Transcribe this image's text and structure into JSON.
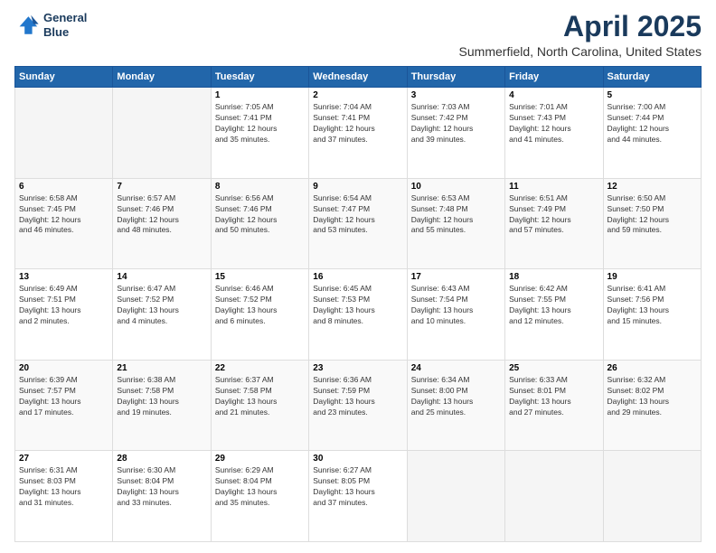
{
  "logo": {
    "line1": "General",
    "line2": "Blue"
  },
  "title": "April 2025",
  "subtitle": "Summerfield, North Carolina, United States",
  "weekdays": [
    "Sunday",
    "Monday",
    "Tuesday",
    "Wednesday",
    "Thursday",
    "Friday",
    "Saturday"
  ],
  "weeks": [
    [
      {
        "day": "",
        "detail": ""
      },
      {
        "day": "",
        "detail": ""
      },
      {
        "day": "1",
        "detail": "Sunrise: 7:05 AM\nSunset: 7:41 PM\nDaylight: 12 hours\nand 35 minutes."
      },
      {
        "day": "2",
        "detail": "Sunrise: 7:04 AM\nSunset: 7:41 PM\nDaylight: 12 hours\nand 37 minutes."
      },
      {
        "day": "3",
        "detail": "Sunrise: 7:03 AM\nSunset: 7:42 PM\nDaylight: 12 hours\nand 39 minutes."
      },
      {
        "day": "4",
        "detail": "Sunrise: 7:01 AM\nSunset: 7:43 PM\nDaylight: 12 hours\nand 41 minutes."
      },
      {
        "day": "5",
        "detail": "Sunrise: 7:00 AM\nSunset: 7:44 PM\nDaylight: 12 hours\nand 44 minutes."
      }
    ],
    [
      {
        "day": "6",
        "detail": "Sunrise: 6:58 AM\nSunset: 7:45 PM\nDaylight: 12 hours\nand 46 minutes."
      },
      {
        "day": "7",
        "detail": "Sunrise: 6:57 AM\nSunset: 7:46 PM\nDaylight: 12 hours\nand 48 minutes."
      },
      {
        "day": "8",
        "detail": "Sunrise: 6:56 AM\nSunset: 7:46 PM\nDaylight: 12 hours\nand 50 minutes."
      },
      {
        "day": "9",
        "detail": "Sunrise: 6:54 AM\nSunset: 7:47 PM\nDaylight: 12 hours\nand 53 minutes."
      },
      {
        "day": "10",
        "detail": "Sunrise: 6:53 AM\nSunset: 7:48 PM\nDaylight: 12 hours\nand 55 minutes."
      },
      {
        "day": "11",
        "detail": "Sunrise: 6:51 AM\nSunset: 7:49 PM\nDaylight: 12 hours\nand 57 minutes."
      },
      {
        "day": "12",
        "detail": "Sunrise: 6:50 AM\nSunset: 7:50 PM\nDaylight: 12 hours\nand 59 minutes."
      }
    ],
    [
      {
        "day": "13",
        "detail": "Sunrise: 6:49 AM\nSunset: 7:51 PM\nDaylight: 13 hours\nand 2 minutes."
      },
      {
        "day": "14",
        "detail": "Sunrise: 6:47 AM\nSunset: 7:52 PM\nDaylight: 13 hours\nand 4 minutes."
      },
      {
        "day": "15",
        "detail": "Sunrise: 6:46 AM\nSunset: 7:52 PM\nDaylight: 13 hours\nand 6 minutes."
      },
      {
        "day": "16",
        "detail": "Sunrise: 6:45 AM\nSunset: 7:53 PM\nDaylight: 13 hours\nand 8 minutes."
      },
      {
        "day": "17",
        "detail": "Sunrise: 6:43 AM\nSunset: 7:54 PM\nDaylight: 13 hours\nand 10 minutes."
      },
      {
        "day": "18",
        "detail": "Sunrise: 6:42 AM\nSunset: 7:55 PM\nDaylight: 13 hours\nand 12 minutes."
      },
      {
        "day": "19",
        "detail": "Sunrise: 6:41 AM\nSunset: 7:56 PM\nDaylight: 13 hours\nand 15 minutes."
      }
    ],
    [
      {
        "day": "20",
        "detail": "Sunrise: 6:39 AM\nSunset: 7:57 PM\nDaylight: 13 hours\nand 17 minutes."
      },
      {
        "day": "21",
        "detail": "Sunrise: 6:38 AM\nSunset: 7:58 PM\nDaylight: 13 hours\nand 19 minutes."
      },
      {
        "day": "22",
        "detail": "Sunrise: 6:37 AM\nSunset: 7:58 PM\nDaylight: 13 hours\nand 21 minutes."
      },
      {
        "day": "23",
        "detail": "Sunrise: 6:36 AM\nSunset: 7:59 PM\nDaylight: 13 hours\nand 23 minutes."
      },
      {
        "day": "24",
        "detail": "Sunrise: 6:34 AM\nSunset: 8:00 PM\nDaylight: 13 hours\nand 25 minutes."
      },
      {
        "day": "25",
        "detail": "Sunrise: 6:33 AM\nSunset: 8:01 PM\nDaylight: 13 hours\nand 27 minutes."
      },
      {
        "day": "26",
        "detail": "Sunrise: 6:32 AM\nSunset: 8:02 PM\nDaylight: 13 hours\nand 29 minutes."
      }
    ],
    [
      {
        "day": "27",
        "detail": "Sunrise: 6:31 AM\nSunset: 8:03 PM\nDaylight: 13 hours\nand 31 minutes."
      },
      {
        "day": "28",
        "detail": "Sunrise: 6:30 AM\nSunset: 8:04 PM\nDaylight: 13 hours\nand 33 minutes."
      },
      {
        "day": "29",
        "detail": "Sunrise: 6:29 AM\nSunset: 8:04 PM\nDaylight: 13 hours\nand 35 minutes."
      },
      {
        "day": "30",
        "detail": "Sunrise: 6:27 AM\nSunset: 8:05 PM\nDaylight: 13 hours\nand 37 minutes."
      },
      {
        "day": "",
        "detail": ""
      },
      {
        "day": "",
        "detail": ""
      },
      {
        "day": "",
        "detail": ""
      }
    ]
  ]
}
